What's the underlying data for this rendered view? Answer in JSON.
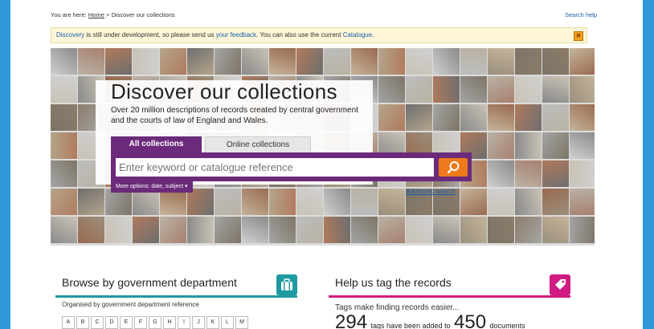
{
  "breadcrumb": {
    "prefix": "You are here:",
    "home": "Home",
    "separator": ">",
    "current": "Discover our collections"
  },
  "search_help": "Search help",
  "notice": {
    "discovery": "Discovery",
    "text1": " is still under development, so please send us ",
    "feedback": "your feedback",
    "text2": ". You can also use the current ",
    "catalogue": "Catalogue",
    "text3": ".",
    "close_icon": "close-icon"
  },
  "hero": {
    "title": "Discover our collections",
    "description": "Over 20 million descriptions of records created by central government and the courts of law of England and Wales.",
    "tabs": [
      "All collections",
      "Online collections"
    ],
    "search_placeholder": "Enter keyword or catalogue reference",
    "search_icon": "magnifier-icon",
    "more_options": "More options: date, subject ▾",
    "advanced": "Advanced search",
    "colors": {
      "purple": "#6b2b7a",
      "orange": "#ee7a1c"
    }
  },
  "browse": {
    "title": "Browse by government department",
    "subtitle": "Organised by government department reference",
    "icon": "briefcase-icon",
    "letters": [
      "A",
      "B",
      "C",
      "D",
      "E",
      "F",
      "G",
      "H",
      "I",
      "J",
      "K",
      "L",
      "M"
    ]
  },
  "tags": {
    "title": "Help us tag the records",
    "subtitle": "Tags make finding records easier...",
    "icon": "tag-icon",
    "count_tags": "294",
    "text_mid": "tags have been added to",
    "count_docs": "450",
    "text_end": "documents"
  }
}
